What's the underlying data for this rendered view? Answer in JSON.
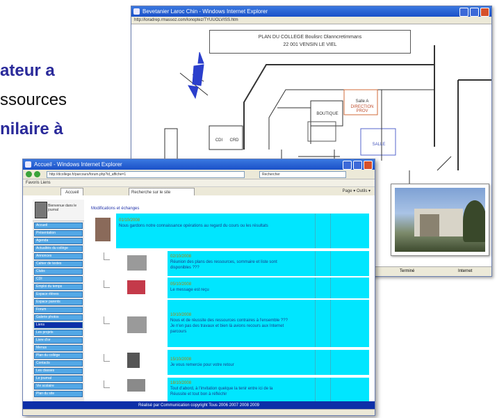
{
  "slide": {
    "line1": "ateur a",
    "line2": "ssources",
    "line3": "nilaire à"
  },
  "back_window": {
    "title": "Bevetanier Laroc Chin - Windows Internet Explorer",
    "address": "http://loradrep.rmassoz.com/lonoptez/TYUUOLVISS.htm",
    "plan_title_1": "PLAN DU COLLEGE Boulisrc Dlanncretimmans",
    "plan_title_2": "22 001  VENSIN LE VIEL",
    "room_labels": [
      "Salle A",
      "DIRECTION PROV",
      "BOUTIQUE",
      "CDI",
      "CRD",
      "SALLE"
    ],
    "status_left": "Terminé",
    "status_right": "Internet"
  },
  "front_window": {
    "title": "Accueil - Windows Internet Explorer",
    "address": "http://dcollege.fr/parcours/forum.php?id_affiche=1",
    "search": "Rechercher",
    "links": "Favoris  Liens",
    "tab": "Accueil",
    "tab_search": "Recherche sur le site",
    "tools": "Page ▾  Outils ▾",
    "user_label": "Bienvenue dans le journal",
    "forum_title": "Modifications et échanges",
    "side_items": [
      "Accueil",
      "Présentation",
      "Agenda",
      "Actualités du collège",
      "Annonces",
      "Cahier de textes",
      "Clubs",
      "CDI",
      "Emploi du temps",
      "Espace élèves",
      "Espace parents",
      "Forum",
      "Galerie photos",
      "Liens",
      "Les projets",
      "Livre d'or",
      "Menus",
      "Plan du collège",
      "Contacts",
      "Les classes",
      "Le journal",
      "Vie scolaire",
      "Plan du site"
    ],
    "selected_index": 13,
    "messages": [
      {
        "date": "01/10/2008",
        "text": "Nous gardons notre connaissance opérations au regard du cours ou les résultats"
      },
      {
        "date": "02/10/2008",
        "text": "Réunion des plans des ressources, sommaire et liste sont disponibles ???"
      },
      {
        "date": "05/10/2008",
        "text": "Le message est reçu"
      },
      {
        "date": "10/10/2008",
        "text": "Nous et de réussite des ressources contraires à l'ensemble ??? Je n'en pas des travaux et bien là avions recours aux Internet parcours"
      },
      {
        "date": "15/10/2008",
        "text": "Je vous remercie pour votre retour"
      },
      {
        "date": "18/10/2008",
        "text": "Tout d'abord, à l'invitation quelque la tenir entre ici de la Réussite et tout bon à réfléchir"
      }
    ],
    "footer": "Réalisé par Communication copyright Tous 2006 2007 2008 2009"
  }
}
